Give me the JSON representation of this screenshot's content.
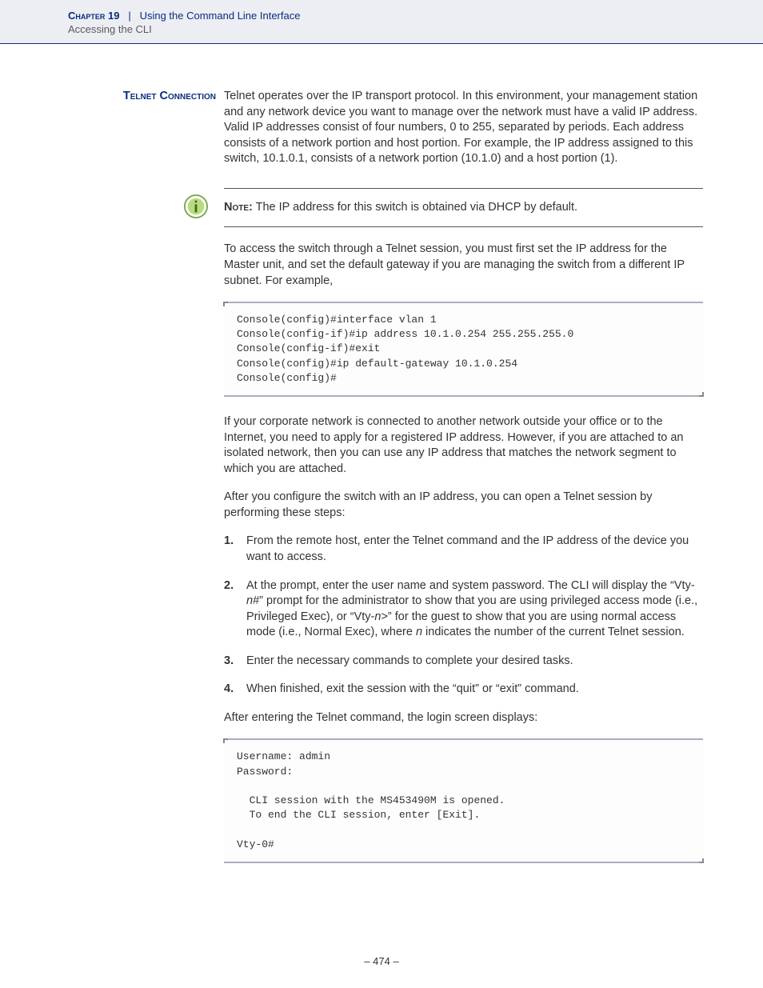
{
  "header": {
    "chapter_label": "Chapter 19",
    "separator": "|",
    "chapter_title": "Using the Command Line Interface",
    "sub": "Accessing the CLI"
  },
  "section": {
    "heading": "Telnet Connection",
    "intro": "Telnet operates over the IP transport protocol. In this environment, your management station and any network device you want to manage over the network must have a valid IP address. Valid IP addresses consist of four numbers, 0 to 255, separated by periods. Each address consists of a network portion and host portion. For example, the IP address assigned to this switch, 10.1.0.1, consists of a network portion (10.1.0) and a host portion (1)."
  },
  "note": {
    "label": "Note:",
    "text": " The IP address for this switch is obtained via DHCP by default."
  },
  "para_access": "To access the switch through a Telnet session, you must first set the IP address for the Master unit, and set the default gateway if you are managing the switch from a different IP subnet. For example,",
  "code1": "Console(config)#interface vlan 1\nConsole(config-if)#ip address 10.1.0.254 255.255.255.0\nConsole(config-if)#exit\nConsole(config)#ip default-gateway 10.1.0.254\nConsole(config)#",
  "para_corp": "If your corporate network is connected to another network outside your office or to the Internet, you need to apply for a registered IP address. However, if you are attached to an isolated network, then you can use any IP address that matches the network segment to which you are attached.",
  "para_after_config": "After you configure the switch with an IP address, you can open a Telnet session by performing these steps:",
  "steps": [
    {
      "num": "1.",
      "text_pre": "From the remote host, enter the Telnet command and the IP address of the device you want to access."
    },
    {
      "num": "2.",
      "text_pre": "At the prompt, enter the user name and system password. The CLI will display the “Vty-",
      "em1": "n",
      "mid1": "#” prompt for the administrator to show that you are using privileged access mode (i.e., Privileged Exec), or “Vty-",
      "em2": "n",
      "mid2": ">” for the guest to show that you are using normal access mode (i.e., Normal Exec), where ",
      "em3": "n",
      "post": " indicates the number of the current Telnet session."
    },
    {
      "num": "3.",
      "text_pre": "Enter the necessary commands to complete your desired tasks."
    },
    {
      "num": "4.",
      "text_pre": "When finished, exit the session with the “quit” or “exit” command."
    }
  ],
  "para_after_entering": "After entering the Telnet command, the login screen displays:",
  "code2": "Username: admin\nPassword:\n\n  CLI session with the MS453490M is opened.\n  To end the CLI session, enter [Exit].\n\nVty-0#",
  "page_number": "–  474  –"
}
